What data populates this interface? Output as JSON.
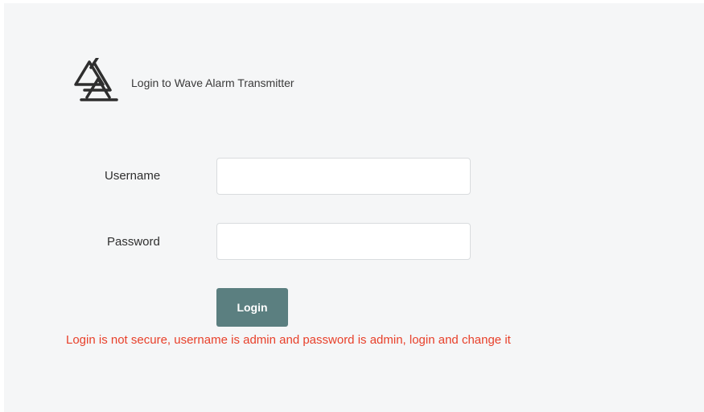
{
  "header": {
    "title": "Login to Wave Alarm Transmitter",
    "logo_icon": "triangle-logo-icon"
  },
  "form": {
    "username_label": "Username",
    "username_value": "",
    "username_placeholder": "",
    "password_label": "Password",
    "password_value": "",
    "password_placeholder": "",
    "login_label": "Login"
  },
  "message": {
    "warning": "Login is not secure, username is admin and password is admin, login and change it"
  },
  "colors": {
    "panel_background": "#f5f6f7",
    "button_background": "#5b7f80",
    "warning_text": "#e8402a"
  }
}
